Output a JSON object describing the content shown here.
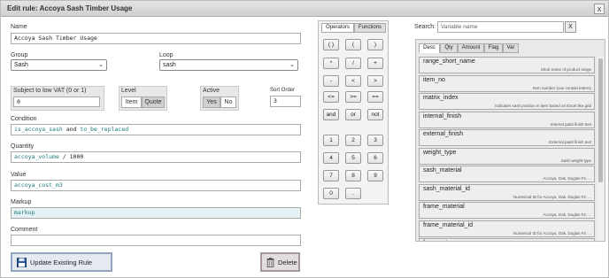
{
  "dialog": {
    "title": "Edit rule: Accoya Sash Timber Usage",
    "close_glyph": "x"
  },
  "form": {
    "name_label": "Name",
    "name_value": "Accoya Sash Timber Usage",
    "group_label": "Group",
    "group_value": "Sash",
    "loop_label": "Loop",
    "loop_value": "sash",
    "vat_label": "Subject to low VAT (0 or 1)",
    "vat_value": "0",
    "level_label": "Level",
    "level_options": [
      "Item",
      "Quote"
    ],
    "level_selected": "Quote",
    "active_label": "Active",
    "active_options": [
      "Yes",
      "No"
    ],
    "active_selected": "Yes",
    "sort_label": "Sort Order",
    "sort_value": "3",
    "condition_label": "Condition",
    "condition_parts": [
      "is_accoya_sash",
      "and",
      "to_be_replaced"
    ],
    "quantity_label": "Quantity",
    "quantity_parts": [
      "accoya_volume",
      "/ 1000"
    ],
    "value_label": "Value",
    "value_value": "accoya_cost_m3",
    "markup_label": "Markup",
    "markup_value": "markup",
    "comment_label": "Comment",
    "comment_value": ""
  },
  "actions": {
    "update_label": "Update Existing Rule",
    "delete_label": "Delete"
  },
  "calculator": {
    "tabs": [
      "Operators",
      "Functions"
    ],
    "active_tab": "Operators",
    "keys": [
      [
        "( )",
        "(",
        ")"
      ],
      [
        "*",
        "/",
        "+"
      ],
      [
        "-",
        "<",
        ">"
      ],
      [
        "<=",
        ">=",
        "=="
      ],
      [
        "and",
        "or",
        "not"
      ],
      [
        "1",
        "2",
        "3"
      ],
      [
        "4",
        "5",
        "6"
      ],
      [
        "7",
        "8",
        "9"
      ],
      [
        "0",
        "."
      ]
    ]
  },
  "search": {
    "label": "Search:",
    "placeholder": "Variable name",
    "clear_label": "X"
  },
  "variables": {
    "tabs": [
      "Desc",
      "Qty",
      "Amount",
      "Flag",
      "Var"
    ],
    "active_tab": "Desc",
    "items": [
      {
        "name": "range_short_name",
        "desc": "Short name of product range"
      },
      {
        "name": "item_no",
        "desc": "Item number (can contain letters)"
      },
      {
        "name": "matrix_index",
        "desc": "Indicates sash position in item based on Excel like grid"
      },
      {
        "name": "internal_finish",
        "desc": "Internal paint finish text"
      },
      {
        "name": "external_finish",
        "desc": "External paint finish text"
      },
      {
        "name": "weight_type",
        "desc": "Sash weight type"
      },
      {
        "name": "sash_material",
        "desc": "Accoya, Oak, Duglas Fir, ..."
      },
      {
        "name": "sash_material_id",
        "desc": "Numerical ID for Accoya, Oak, Duglas Fir, ..."
      },
      {
        "name": "frame_material",
        "desc": "Accoya, Oak, Duglas Fir, ..."
      },
      {
        "name": "frame_material_id",
        "desc": "Numerical ID for Accoya, Oak, Duglas Fir, ..."
      },
      {
        "name": "frame_stop",
        "desc": ""
      }
    ]
  },
  "icons": {
    "save": "floppy-disk-icon",
    "delete": "trash-icon"
  }
}
